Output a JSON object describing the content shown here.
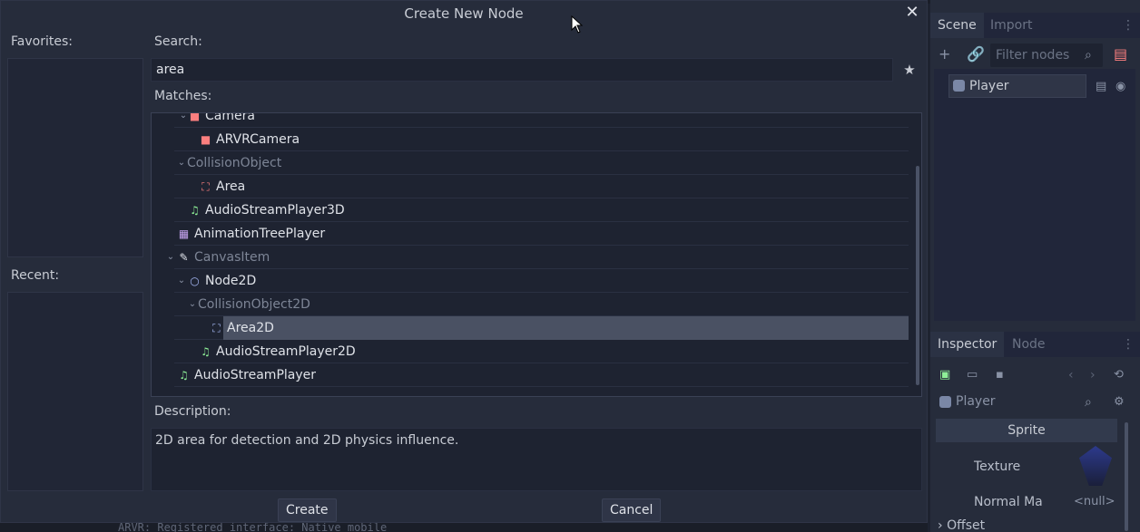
{
  "dialog": {
    "title": "Create New Node",
    "close_icon": "close-icon",
    "favorites_label": "Favorites:",
    "recent_label": "Recent:",
    "search_label": "Search:",
    "search_value": "area",
    "matches_label": "Matches:",
    "description_label": "Description:",
    "description_text": "2D area for detection and 2D physics influence.",
    "create_label": "Create",
    "cancel_label": "Cancel"
  },
  "matches": [
    {
      "label": "Camera",
      "icon": "camera-icon",
      "color": "#fc7f7f",
      "style": "bright",
      "expanded": true
    },
    {
      "label": "ARVRCamera",
      "icon": "camera-icon",
      "color": "#fc7f7f",
      "style": "bright"
    },
    {
      "label": "CollisionObject",
      "icon": "",
      "style": "dim",
      "expanded": true
    },
    {
      "label": "Area",
      "icon": "area-icon",
      "color": "#fc7f7f",
      "style": "bright"
    },
    {
      "label": "AudioStreamPlayer3D",
      "icon": "audio-icon",
      "color": "#8eef97",
      "style": "bright"
    },
    {
      "label": "AnimationTreePlayer",
      "icon": "animation-tree-icon",
      "color": "#c6a4f0",
      "style": "bright"
    },
    {
      "label": "CanvasItem",
      "icon": "brush-icon",
      "color": "#e0e3ea",
      "style": "dim",
      "expanded": true
    },
    {
      "label": "Node2D",
      "icon": "node2d-icon",
      "color": "#a5b7f3",
      "style": "bright",
      "expanded": true
    },
    {
      "label": "CollisionObject2D",
      "icon": "",
      "style": "dim",
      "expanded": true
    },
    {
      "label": "Area2D",
      "icon": "area2d-icon",
      "color": "#a5b7f3",
      "style": "bright",
      "selected": true
    },
    {
      "label": "AudioStreamPlayer2D",
      "icon": "audio-icon",
      "color": "#8eef97",
      "style": "bright"
    },
    {
      "label": "AudioStreamPlayer",
      "icon": "audio-icon",
      "color": "#8eef97",
      "style": "bright"
    }
  ],
  "scene_dock": {
    "tabs": [
      "Scene",
      "Import"
    ],
    "filter_placeholder": "Filter nodes",
    "root_node": "Player"
  },
  "inspector_dock": {
    "tabs": [
      "Inspector",
      "Node"
    ],
    "object_name": "Player",
    "section": "Sprite",
    "properties": [
      {
        "name": "Texture",
        "value": ""
      },
      {
        "name": "Normal Ma",
        "value": "<null>"
      }
    ],
    "offset_label": "Offset"
  },
  "background_text": "ARVR: Registered interface: Native mobile"
}
